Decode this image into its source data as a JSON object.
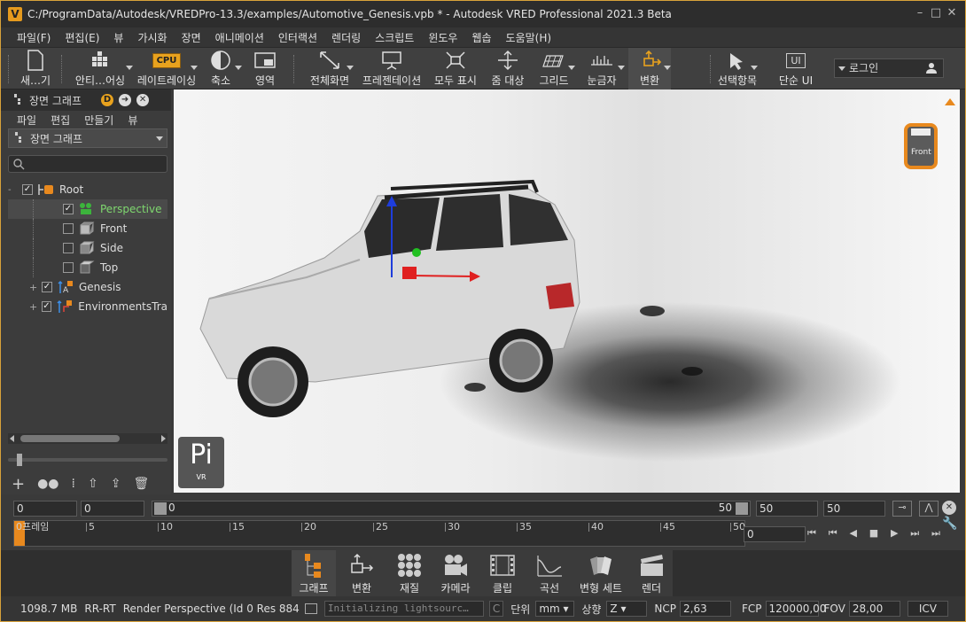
{
  "window": {
    "title": "C:/ProgramData/Autodesk/VREDPro-13.3/examples/Automotive_Genesis.vpb * - Autodesk VRED Professional 2021.3 Beta",
    "app_icon_letter": "V",
    "minimize": "–",
    "maximize": "□",
    "close": "✕"
  },
  "menu": [
    "파일(F)",
    "편집(E)",
    "뷰",
    "가시화",
    "장면",
    "애니메이션",
    "인터랙션",
    "렌더링",
    "스크립트",
    "윈도우",
    "웹솝",
    "도움말(H)"
  ],
  "toolbar": {
    "new": "새…기",
    "antialias": "안티…어싱",
    "raytracing": "레이트레이싱",
    "axis": "축소",
    "region": "영역",
    "fullscreen": "전체화면",
    "presentation": "프레젠테이션",
    "show_all": "모두 표시",
    "zoom_target": "줌 대상",
    "grid": "그리드",
    "ruler": "눈금자",
    "transform": "변환",
    "selection": "선택항목",
    "simple_ui": "단순 UI",
    "cpu_label": "CPU",
    "ui_label": "UI",
    "login": "로그인"
  },
  "scene_panel": {
    "title": "장면 그래프",
    "badge": "D",
    "menu": [
      "파일",
      "편집",
      "만들기",
      "뷰"
    ],
    "dropdown": "장면 그래프",
    "tree": [
      {
        "label": "Root",
        "checked": true,
        "expander": "-",
        "indent": 0
      },
      {
        "label": "Perspective",
        "checked": true,
        "expander": "",
        "indent": 1
      },
      {
        "label": "Front",
        "checked": false,
        "expander": "",
        "indent": 1
      },
      {
        "label": "Side",
        "checked": false,
        "expander": "",
        "indent": 1
      },
      {
        "label": "Top",
        "checked": false,
        "expander": "",
        "indent": 1
      },
      {
        "label": "Genesis",
        "checked": true,
        "expander": "+",
        "indent": 1
      },
      {
        "label": "EnvironmentsTra",
        "checked": true,
        "expander": "+",
        "indent": 1
      }
    ]
  },
  "viewport": {
    "cube_label": "Front",
    "logo": "Pi",
    "logo_sub": "VR"
  },
  "timeline": {
    "start": "0",
    "current": "0",
    "slider_min": "0",
    "slider_max": "50",
    "range_start": "50",
    "range_end": "50",
    "frame_label": "0프레임",
    "ticks": [
      "5",
      "10",
      "15",
      "20",
      "25",
      "30",
      "35",
      "40",
      "45",
      "50"
    ],
    "frame_value": "0"
  },
  "modules": [
    "그래프",
    "변환",
    "재질",
    "카메라",
    "클립",
    "곡선",
    "변형 세트",
    "렌더"
  ],
  "status": {
    "memory": "1098.7 MB",
    "mode": "RR-RT",
    "render_info": "Render Perspective (Id 0 Res 884",
    "message": "Initializing lightsourc…",
    "c_label": "C",
    "unit_label": "단위",
    "unit_value": "mm",
    "up_label": "상향",
    "up_value": "Z",
    "ncp_label": "NCP",
    "ncp_value": "2,63",
    "fcp_label": "FCP",
    "fcp_value": "120000,00",
    "fov_label": "FOV",
    "fov_value": "28,00",
    "icv_label": "ICV"
  }
}
